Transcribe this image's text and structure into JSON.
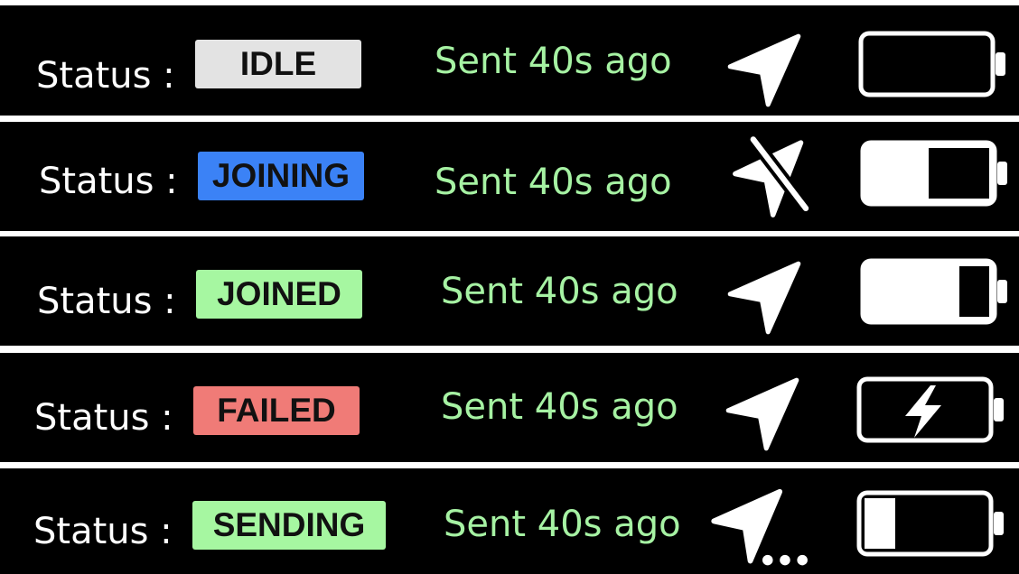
{
  "colors": {
    "background": "#000000",
    "separator": "#ffffff",
    "label": "#ffffff",
    "sent_text": "#a6f2a3",
    "idle": "#e3e3e3",
    "joining": "#3b82f6",
    "joined": "#a6f7a1",
    "failed": "#f07b77",
    "sending": "#a6f7a1"
  },
  "rows": [
    {
      "status_label": "Status :",
      "badge_text": "IDLE",
      "sent_text": "Sent 40s ago",
      "location_icon": "navigation-arrow-icon",
      "battery_icon": "battery-empty-icon",
      "battery_level": 0
    },
    {
      "status_label": "Status :",
      "badge_text": "JOINING",
      "sent_text": "Sent 40s ago",
      "location_icon": "navigation-off-icon",
      "battery_icon": "battery-half-icon",
      "battery_level": 0.5
    },
    {
      "status_label": "Status :",
      "badge_text": "JOINED",
      "sent_text": "Sent 40s ago",
      "location_icon": "navigation-arrow-icon",
      "battery_icon": "battery-high-icon",
      "battery_level": 0.75
    },
    {
      "status_label": "Status :",
      "badge_text": "FAILED",
      "sent_text": "Sent 40s ago",
      "location_icon": "navigation-arrow-icon",
      "battery_icon": "battery-charging-icon",
      "battery_level": 0
    },
    {
      "status_label": "Status :",
      "badge_text": "SENDING",
      "sent_text": "Sent 40s ago",
      "location_icon": "navigation-sending-icon",
      "battery_icon": "battery-low-icon",
      "battery_level": 0.25
    }
  ]
}
